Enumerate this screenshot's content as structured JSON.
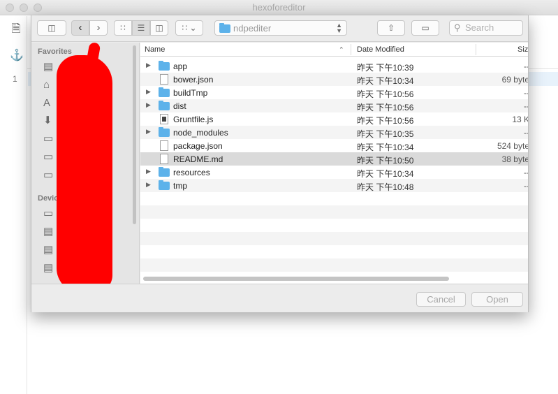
{
  "window": {
    "title": "hexoforeditor"
  },
  "editor": {
    "line_number": "1"
  },
  "dialog": {
    "path": "ndpediter",
    "search_placeholder": "Search",
    "sidebar": {
      "favorites_label": "Favorites",
      "devices_label": "Devic"
    },
    "columns": {
      "name": "Name",
      "date": "Date Modified",
      "size": "Siz"
    },
    "files": [
      {
        "name": "app",
        "kind": "folder",
        "date": "昨天 下午10:39",
        "size": "--"
      },
      {
        "name": "bower.json",
        "kind": "doc",
        "date": "昨天 下午10:34",
        "size": "69 byte"
      },
      {
        "name": "buildTmp",
        "kind": "folder",
        "date": "昨天 下午10:56",
        "size": "--"
      },
      {
        "name": "dist",
        "kind": "folder",
        "date": "昨天 下午10:56",
        "size": "--"
      },
      {
        "name": "Gruntfile.js",
        "kind": "js",
        "date": "昨天 下午10:56",
        "size": "13 K"
      },
      {
        "name": "node_modules",
        "kind": "folder",
        "date": "昨天 下午10:35",
        "size": "--"
      },
      {
        "name": "package.json",
        "kind": "doc",
        "date": "昨天 下午10:34",
        "size": "524 byte"
      },
      {
        "name": "README.md",
        "kind": "doc",
        "date": "昨天 下午10:50",
        "size": "38 byte",
        "selected": true
      },
      {
        "name": "resources",
        "kind": "folder",
        "date": "昨天 下午10:34",
        "size": "--"
      },
      {
        "name": "tmp",
        "kind": "folder",
        "date": "昨天 下午10:48",
        "size": "--"
      }
    ],
    "buttons": {
      "cancel": "Cancel",
      "open": "Open"
    }
  }
}
